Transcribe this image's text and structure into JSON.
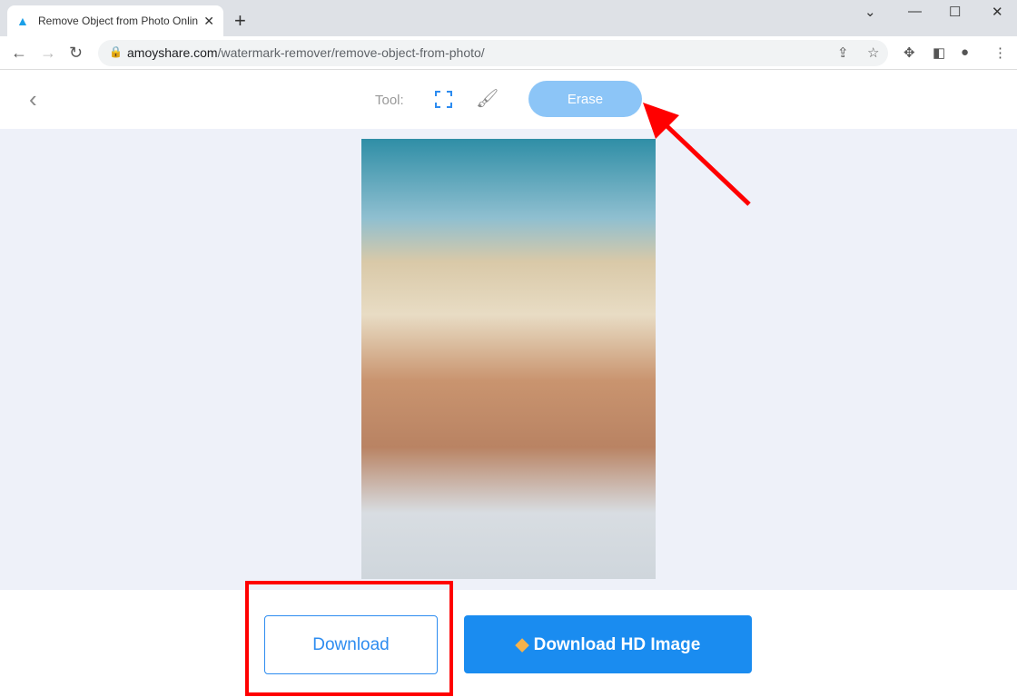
{
  "browser": {
    "tab_title": "Remove Object from Photo Online",
    "url_domain": "amoyshare.com",
    "url_path": "/watermark-remover/remove-object-from-photo/"
  },
  "toolbar": {
    "tool_label": "Tool:",
    "erase_label": "Erase"
  },
  "actions": {
    "download_label": "Download",
    "download_hd_label": "Download HD Image"
  },
  "colors": {
    "accent": "#1a8cf0",
    "erase_disabled": "#8cc5f7",
    "highlight": "#ff0000"
  }
}
